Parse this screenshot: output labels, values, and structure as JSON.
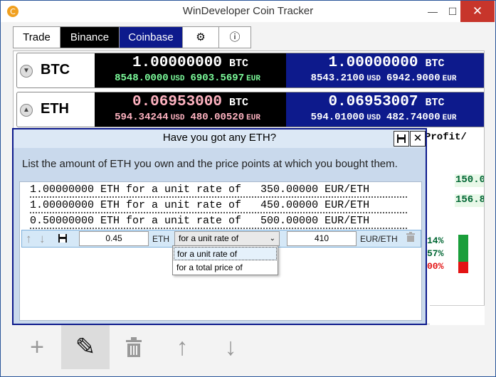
{
  "window": {
    "title": "WinDeveloper Coin Tracker",
    "min": "—",
    "max": "☐",
    "close": "✕"
  },
  "tabs": {
    "trade": "Trade",
    "binance": "Binance",
    "coinbase": "Coinbase",
    "settings_icon": "⚙",
    "info_icon": "ⓘ"
  },
  "coins": [
    {
      "name": "BTC",
      "binance": {
        "amount": "1.00000000",
        "unit": "BTC",
        "usd": "8548.0000",
        "usd_label": "USD",
        "eur": "6903.5697",
        "eur_label": "EUR"
      },
      "coinbase": {
        "amount": "1.00000000",
        "unit": "BTC",
        "usd": "8543.2100",
        "usd_label": "USD",
        "eur": "6942.9000",
        "eur_label": "EUR"
      }
    },
    {
      "name": "ETH",
      "binance": {
        "amount": "0.06953000",
        "unit": "BTC",
        "usd": "594.34244",
        "usd_label": "USD",
        "eur": "480.00520",
        "eur_label": "EUR"
      },
      "coinbase": {
        "amount": "0.06953007",
        "unit": "BTC",
        "usd": "594.01000",
        "usd_label": "USD",
        "eur": "482.74000",
        "eur_label": "EUR"
      }
    }
  ],
  "background": {
    "profit_header": "Profit/",
    "values": [
      "150.0",
      "156.8"
    ],
    "percents": [
      "14%",
      "57%",
      "00%"
    ],
    "bar_colors": [
      "#1a9e3a",
      "#e31414"
    ]
  },
  "dialog": {
    "title": "Have you got any ETH?",
    "save_icon": "💾",
    "close_icon": "✕",
    "instructions": "List the amount of ETH you own and the price points at which you bought them.",
    "entries": [
      "1.00000000 ETH for a unit rate of   350.00000 EUR/ETH",
      "1.00000000 ETH for a unit rate of   450.00000 EUR/ETH",
      "0.50000000 ETH for a unit rate of   500.00000 EUR/ETH"
    ],
    "edit": {
      "amount": "0.45",
      "amount_unit": "ETH",
      "mode": "for a unit rate of",
      "price": "410",
      "price_unit": "EUR/ETH"
    },
    "dropdown_options": [
      "for a unit rate of",
      "for a total price of"
    ]
  },
  "toolbar": {
    "add": "+",
    "edit": "✎",
    "delete": "🗑",
    "up": "↑",
    "down": "↓"
  }
}
